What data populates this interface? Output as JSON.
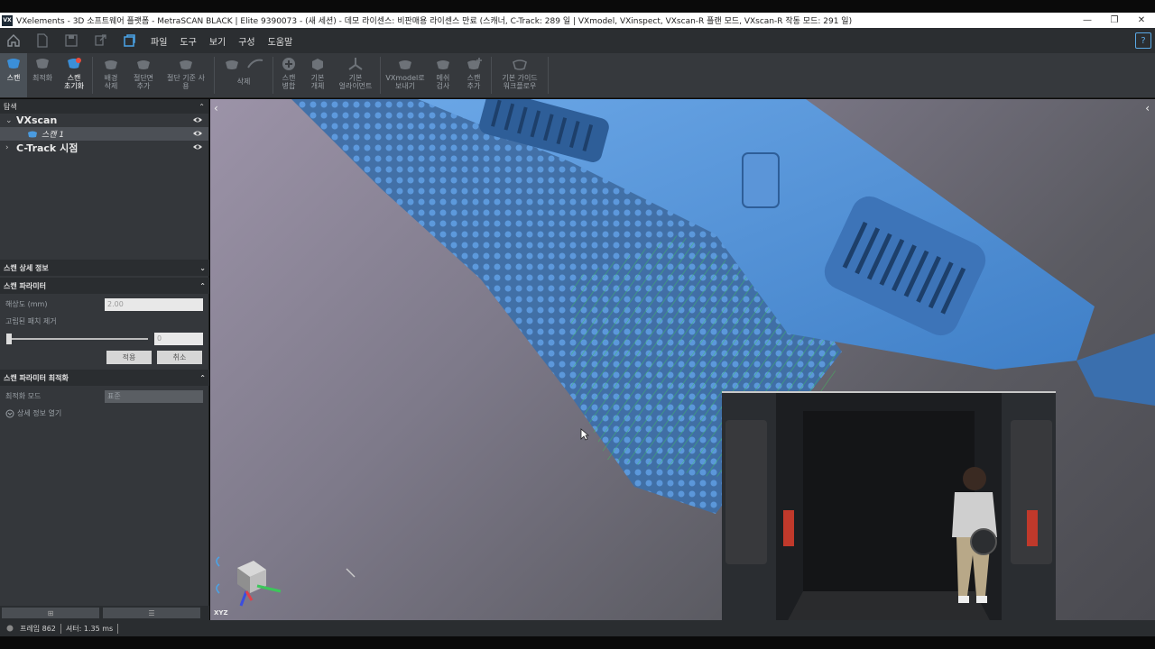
{
  "window": {
    "title": "VXelements - 3D 소프트웨어 플랫폼 - MetraSCAN BLACK | Elite 9390073 - (새 세션) - 데모 라이센스: 비판매용 라이센스 만료 (스캐너, C-Track: 289 일 | VXmodel, VXinspect, VXscan-R 플랜 모드, VXscan-R 작동 모드: 291 일)",
    "app_icon": "VX"
  },
  "menu": [
    "파일",
    "도구",
    "보기",
    "구성",
    "도움말"
  ],
  "help_label": "?",
  "ribbon": {
    "scan": "스캔",
    "optimize": "최적화",
    "scan_reset": "스캔\n초기화",
    "background_delete": "배경\n삭제",
    "add_cut_plane": "절단면\n추가",
    "use_cut_reference": "절단 기준 사\n용",
    "delete": "삭제",
    "merge_scans": "스캔\n병합",
    "basic_entity": "기본\n개체",
    "basic_alignment": "기본\n얼라이먼트",
    "send_vxmodel": "VXmodel로\n보내기",
    "mesh_inspect": "메쉬\n검사",
    "add_scan": "스캔\n추가",
    "basic_guide": "기본 가이드\n워크플로우"
  },
  "explorer": {
    "title": "탐색",
    "root": "VXscan",
    "child": "스캔 1",
    "ctrack": "C-Track 시점"
  },
  "scan_details": {
    "title": "스캔 상세 정보"
  },
  "scan_params": {
    "title": "스캔 파라미터",
    "resolution_label": "해상도 (mm)",
    "resolution_value": "2.00",
    "isolated_label": "고립된 패치 제거",
    "isolated_value": "0",
    "apply": "적용",
    "cancel": "취소"
  },
  "optimize_params": {
    "title": "스캔 파라미터 최적화",
    "mode_label": "최적화 모드",
    "mode_value": "표준",
    "open_details": "상세 정보 열기"
  },
  "axes_label": "XYZ",
  "status": {
    "frames": "프레임 862",
    "shutter": "셔터: 1.35 ms"
  },
  "colors": {
    "scan_blue": "#4f8fd6",
    "accent_green": "#3cc75a"
  }
}
